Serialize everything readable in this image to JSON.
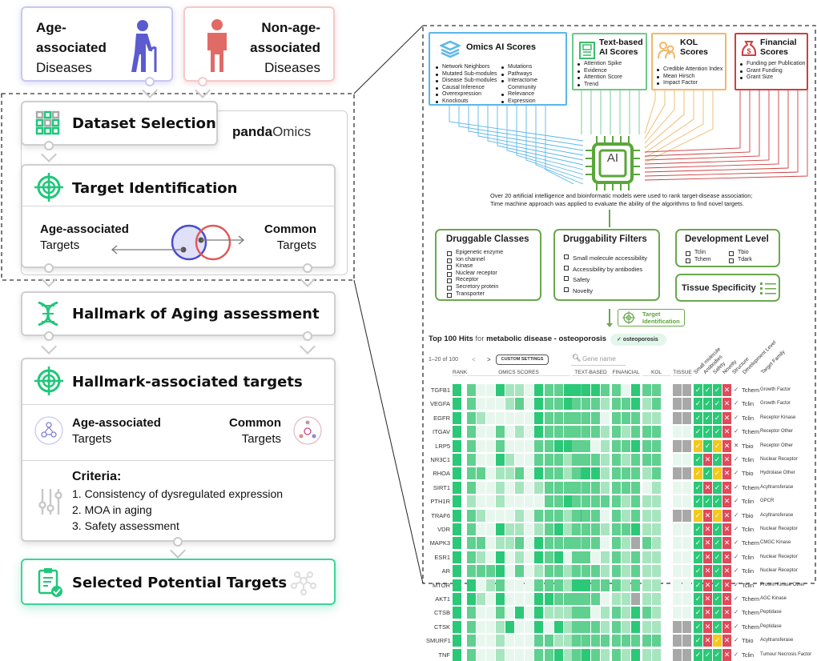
{
  "left": {
    "age_disease": {
      "line1": "Age-",
      "line2": "associated",
      "line3": "Diseases",
      "icon": "elderly-person-icon",
      "color": "#5b5bcf"
    },
    "nonage_disease": {
      "line1": "Non-age-",
      "line2": "associated",
      "line3": "Diseases",
      "icon": "person-icon",
      "color": "#e06b66"
    },
    "dataset_selection": {
      "title": "Dataset Selection",
      "icon": "grid-icon"
    },
    "brand": {
      "part1": "panda",
      "part2": "Omics"
    },
    "target_identification": {
      "title": "Target Identification",
      "age_label": "Age-associated",
      "age_sub": "Targets",
      "common_label": "Common",
      "common_sub": "Targets"
    },
    "hallmark_assessment": {
      "title": "Hallmark of Aging assessment",
      "icon": "dna-icon"
    },
    "hallmark_targets": {
      "title": "Hallmark-associated targets",
      "age_label": "Age-associated",
      "age_sub": "Targets",
      "common_label": "Common",
      "common_sub": "Targets"
    },
    "criteria": {
      "title": "Criteria:",
      "items": [
        "1.  Consistency of dysregulated expression",
        "2. MOA in aging",
        "3. Safety assessment"
      ]
    },
    "selected": {
      "title": "Selected Potential Targets"
    }
  },
  "right": {
    "omics": {
      "title": "Omics AI Scores",
      "color": "#5bb7ea",
      "col1": [
        "Network Neighbors",
        "Mutated Sub-modules",
        "Disease Sub-modules",
        "Causal Inference",
        "Overexpression",
        "Knockouts"
      ],
      "col2": [
        "Mutations",
        "Pathways",
        "Interactome Community",
        "Relevance",
        "Expression"
      ]
    },
    "text": {
      "title1": "Text-based",
      "title2": "AI Scores",
      "color": "#6cc98a",
      "items": [
        "Attention Spike",
        "Evidence",
        "Attention Score",
        "Trend"
      ]
    },
    "kol": {
      "title1": "KOL",
      "title2": "Scores",
      "color": "#f1b866",
      "items": [
        "Credible Attention Index",
        "Mean Hirsch",
        "Impact Factor"
      ]
    },
    "financial": {
      "title1": "Financial",
      "title2": "Scores",
      "color": "#cf3f3f",
      "items": [
        "Funding per Publication",
        "Grant Funding",
        "Grant Size"
      ]
    },
    "ai_label": "AI",
    "caption1": "Over 20 artificial intelligence and bioinformatic models were used to rank target-disease association;",
    "caption2": "Time machine approach was applied to evaluate the ability of the algorithms to find novel targets.",
    "druggable_classes": {
      "title": "Druggable Classes",
      "items": [
        "Epigenetic enzyme",
        "Ion channel",
        "Kinase",
        "Nuclear receptor",
        "Receptor",
        "Secretory protein",
        "Transporter"
      ]
    },
    "druggability_filters": {
      "title": "Druggability Filters",
      "items": [
        "Small molecule accessibility",
        "Accessibility by antibodies",
        "Safety",
        "Novelty"
      ]
    },
    "development_level": {
      "title": "Development Level",
      "items": [
        "Tclin",
        "Tchem",
        "Tbio",
        "Tdark"
      ]
    },
    "tissue_specificity": {
      "title": "Tissue Specificity"
    },
    "target_id_badge": {
      "line1": "Target",
      "line2": "Identification"
    }
  },
  "table": {
    "title_bold1": "Top 100 Hits",
    "title_for": "for",
    "title_bold2": "metabolic disease - osteoporosis",
    "chip": "osteoporosis",
    "pagination": "1–20 of 100",
    "prev": "<",
    "next": ">",
    "custom_settings": "CUSTOM SETTINGS",
    "search_placeholder": "Gene name",
    "groups": [
      "RANK",
      "OMICS SCORES",
      "TEXT-BASED",
      "FINANCIAL",
      "KOL",
      "TISSUE"
    ],
    "rot_headers": [
      "Small molecule",
      "Antibodies",
      "Safety",
      "Novelty",
      "Structure",
      "Development Level",
      "Target Family"
    ],
    "rows": [
      {
        "gene": "TGFB1",
        "v": [
          4,
          3,
          1,
          1,
          4,
          2,
          2,
          1,
          4,
          3,
          3,
          4,
          3,
          4,
          4,
          4,
          3,
          3,
          1,
          4,
          3,
          3
        ],
        "t": "gg",
        "c": "yyyn",
        "ok": true,
        "dev": "Tchem",
        "fam": "Growth Factor"
      },
      {
        "gene": "VEGFA",
        "v": [
          4,
          3,
          1,
          1,
          1,
          2,
          3,
          1,
          4,
          3,
          3,
          4,
          1,
          3,
          3,
          3,
          2,
          3,
          3,
          4,
          2,
          3
        ],
        "t": "gg",
        "c": "yyyn",
        "ok": true,
        "dev": "Tclin",
        "fam": "Growth Factor"
      },
      {
        "gene": "EGFR",
        "v": [
          4,
          3,
          2,
          1,
          1,
          1,
          1,
          1,
          4,
          3,
          3,
          3,
          2,
          3,
          3,
          3,
          1,
          3,
          3,
          3,
          2,
          2
        ],
        "t": "gg",
        "c": "yyyn",
        "ok": true,
        "dev": "Tclin",
        "fam": "Receptor Kinase"
      },
      {
        "gene": "ITGAV",
        "v": [
          4,
          3,
          1,
          1,
          3,
          1,
          2,
          1,
          4,
          3,
          3,
          3,
          2,
          3,
          3,
          3,
          2,
          3,
          2,
          3,
          3,
          3
        ],
        "t": "ll",
        "c": "yyyn",
        "ok": true,
        "dev": "Tchem",
        "fam": "Receptor Other"
      },
      {
        "gene": "LRP5",
        "v": [
          4,
          3,
          1,
          1,
          3,
          1,
          1,
          1,
          3,
          3,
          4,
          4,
          3,
          3,
          3,
          1,
          2,
          3,
          3,
          4,
          3,
          3
        ],
        "t": "gg",
        "c": "wywn",
        "ok": false,
        "dev": "Tbio",
        "fam": "Receptor Other"
      },
      {
        "gene": "NR3C1",
        "v": [
          4,
          3,
          1,
          1,
          4,
          2,
          1,
          1,
          3,
          3,
          3,
          2,
          3,
          3,
          3,
          3,
          2,
          3,
          2,
          3,
          3,
          3
        ],
        "t": "ll",
        "c": "ynyn",
        "ok": true,
        "dev": "Tclin",
        "fam": "Nuclear Receptor"
      },
      {
        "gene": "RHOA",
        "v": [
          4,
          3,
          3,
          1,
          2,
          2,
          3,
          1,
          4,
          3,
          3,
          2,
          4,
          3,
          4,
          4,
          2,
          3,
          3,
          3,
          2,
          3
        ],
        "t": "gg",
        "c": "wywn",
        "ok": true,
        "dev": "Tbio",
        "fam": "Hydrolase Other"
      },
      {
        "gene": "SIRT1",
        "v": [
          4,
          3,
          1,
          1,
          2,
          1,
          2,
          1,
          2,
          3,
          3,
          3,
          2,
          3,
          3,
          3,
          2,
          3,
          3,
          3,
          1,
          2
        ],
        "t": "ll",
        "c": "ynyn",
        "ok": true,
        "dev": "Tchem",
        "fam": "Acyltransferase"
      },
      {
        "gene": "PTH1R",
        "v": [
          4,
          2,
          1,
          1,
          2,
          1,
          1,
          1,
          1,
          3,
          3,
          4,
          1,
          3,
          3,
          3,
          3,
          3,
          2,
          3,
          2,
          2
        ],
        "t": "ll",
        "c": "yyyn",
        "ok": true,
        "dev": "Tclin",
        "fam": "GPCR"
      },
      {
        "gene": "TRAF6",
        "v": [
          4,
          3,
          2,
          1,
          1,
          1,
          2,
          1,
          3,
          3,
          3,
          2,
          4,
          3,
          3,
          3,
          1,
          3,
          2,
          3,
          2,
          2
        ],
        "t": "gg",
        "c": "wnwn",
        "ok": true,
        "dev": "Tbio",
        "fam": "Acyltransferase"
      },
      {
        "gene": "VDR",
        "v": [
          4,
          3,
          1,
          1,
          4,
          2,
          2,
          1,
          2,
          3,
          4,
          2,
          1,
          3,
          3,
          3,
          2,
          3,
          3,
          4,
          2,
          2
        ],
        "t": "ll",
        "c": "ynyn",
        "ok": true,
        "dev": "Tclin",
        "fam": "Nuclear Receptor"
      },
      {
        "gene": "MAPK3",
        "v": [
          4,
          3,
          3,
          1,
          2,
          2,
          3,
          1,
          4,
          3,
          3,
          3,
          2,
          3,
          3,
          3,
          1,
          3,
          2,
          0,
          3,
          2
        ],
        "t": "ll",
        "c": "ynyn",
        "ok": true,
        "dev": "Tchem",
        "fam": "CMGC Kinase"
      },
      {
        "gene": "ESR1",
        "v": [
          4,
          3,
          2,
          1,
          4,
          1,
          2,
          1,
          4,
          3,
          4,
          1,
          3,
          3,
          3,
          1,
          2,
          3,
          2,
          3,
          2,
          2
        ],
        "t": "ll",
        "c": "ynyn",
        "ok": true,
        "dev": "Tclin",
        "fam": "Nuclear Receptor"
      },
      {
        "gene": "AR",
        "v": [
          4,
          3,
          3,
          3,
          4,
          1,
          3,
          1,
          2,
          3,
          3,
          2,
          1,
          3,
          3,
          3,
          2,
          3,
          2,
          3,
          2,
          2
        ],
        "t": "ll",
        "c": "ynyn",
        "ok": true,
        "dev": "Tclin",
        "fam": "Nuclear Receptor"
      },
      {
        "gene": "MTOR",
        "v": [
          4,
          4,
          1,
          2,
          3,
          1,
          1,
          1,
          3,
          3,
          3,
          2,
          4,
          4,
          4,
          3,
          3,
          3,
          2,
          3,
          2,
          2
        ],
        "t": "ll",
        "c": "ynyn",
        "ok": true,
        "dev": "Tclin",
        "fam": "Protein Kinase Other"
      },
      {
        "gene": "AKT1",
        "v": [
          4,
          4,
          2,
          1,
          4,
          1,
          1,
          1,
          4,
          4,
          3,
          3,
          3,
          3,
          3,
          3,
          1,
          2,
          2,
          0,
          2,
          2
        ],
        "t": "ll",
        "c": "ynyn",
        "ok": true,
        "dev": "Tchem",
        "fam": "AGC Kinase"
      },
      {
        "gene": "CTSB",
        "v": [
          4,
          3,
          1,
          1,
          3,
          1,
          4,
          1,
          4,
          2,
          2,
          2,
          3,
          3,
          3,
          1,
          2,
          3,
          2,
          4,
          3,
          2
        ],
        "t": "ll",
        "c": "ynyn",
        "ok": true,
        "dev": "Tchem",
        "fam": "Peptidase"
      },
      {
        "gene": "CTSK",
        "v": [
          4,
          3,
          1,
          1,
          2,
          4,
          1,
          1,
          4,
          1,
          4,
          2,
          3,
          3,
          3,
          3,
          2,
          3,
          2,
          4,
          2,
          2
        ],
        "t": "gg",
        "c": "ynyn",
        "ok": true,
        "dev": "Tchem",
        "fam": "Peptidase"
      },
      {
        "gene": "SMURF1",
        "v": [
          4,
          3,
          1,
          1,
          2,
          1,
          1,
          1,
          3,
          3,
          2,
          2,
          2,
          3,
          3,
          3,
          3,
          3,
          3,
          3,
          3,
          3
        ],
        "t": "gg",
        "c": "ynwn",
        "ok": true,
        "dev": "Tbio",
        "fam": "Acyltransferase"
      },
      {
        "gene": "TNF",
        "v": [
          4,
          3,
          1,
          1,
          2,
          1,
          1,
          1,
          3,
          3,
          4,
          2,
          2,
          3,
          4,
          3,
          2,
          3,
          2,
          4,
          2,
          2
        ],
        "t": "gg",
        "c": "yyyn",
        "ok": true,
        "dev": "Tclin",
        "fam": "Tumour Necrosis Factor"
      }
    ]
  }
}
